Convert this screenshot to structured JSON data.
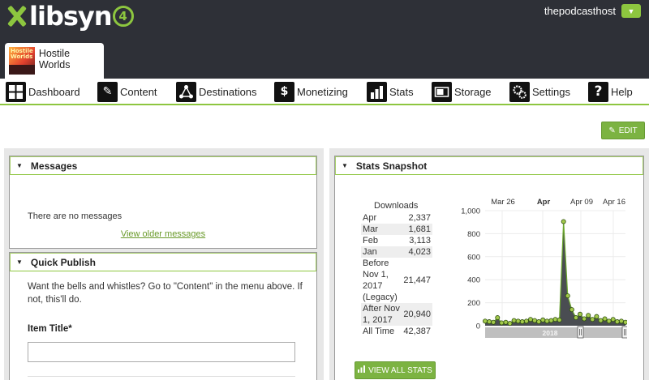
{
  "header": {
    "logo_text": "libsyn",
    "logo_badge": "4",
    "username": "thepodcasthost",
    "show_name": "Hostile Worlds",
    "show_art_text": "Hostile Worlds"
  },
  "nav": {
    "items": [
      {
        "label": "Dashboard",
        "icon": "dashboard-icon"
      },
      {
        "label": "Content",
        "icon": "content-icon"
      },
      {
        "label": "Destinations",
        "icon": "destinations-icon"
      },
      {
        "label": "Monetizing",
        "icon": "dollar-icon"
      },
      {
        "label": "Stats",
        "icon": "stats-icon"
      },
      {
        "label": "Storage",
        "icon": "storage-icon"
      },
      {
        "label": "Settings",
        "icon": "settings-icon"
      },
      {
        "label": "Help",
        "icon": "help-icon"
      }
    ]
  },
  "toolbar": {
    "edit_label": "EDIT"
  },
  "messages": {
    "title": "Messages",
    "empty_text": "There are no messages",
    "older_link": "View older messages"
  },
  "quick_publish": {
    "title": "Quick Publish",
    "intro": "Want the bells and whistles? Go to \"Content\" in the menu above. If not, this'll do.",
    "item_title_label": "Item Title*",
    "item_title_value": ""
  },
  "stats_snapshot": {
    "title": "Stats Snapshot",
    "downloads_label": "Downloads",
    "rows": [
      {
        "label": "Apr",
        "value": "2,337"
      },
      {
        "label": "Mar",
        "value": "1,681"
      },
      {
        "label": "Feb",
        "value": "3,113"
      },
      {
        "label": "Jan",
        "value": "4,023"
      },
      {
        "label": "Before Nov 1, 2017 (Legacy)",
        "value": "21,447"
      },
      {
        "label": "After Nov 1, 2017",
        "value": "20,940"
      },
      {
        "label": "All Time",
        "value": "42,387"
      }
    ],
    "view_all_label": "VIEW ALL STATS"
  },
  "colors": {
    "accent": "#8dc63f",
    "button": "#7cb342",
    "header_bg": "#2e3037",
    "chart_fill": "#4a4d52",
    "chart_line": "#6aa62c",
    "chart_marker": "#a3c94b"
  },
  "chart_data": {
    "type": "area",
    "x_ticks": [
      "Mar 26",
      "Apr",
      "Apr 09",
      "Apr 16"
    ],
    "x_tick_bold": "Apr",
    "y_ticks": [
      "0",
      "200",
      "400",
      "600",
      "800",
      "1,000"
    ],
    "ylim": [
      0,
      1000
    ],
    "navigator_label": "2018",
    "values": [
      40,
      35,
      30,
      70,
      25,
      30,
      20,
      45,
      40,
      35,
      40,
      55,
      45,
      35,
      50,
      40,
      45,
      55,
      50,
      905,
      260,
      140,
      70,
      100,
      60,
      90,
      55,
      80,
      45,
      60,
      40,
      55,
      35,
      40,
      30
    ]
  }
}
